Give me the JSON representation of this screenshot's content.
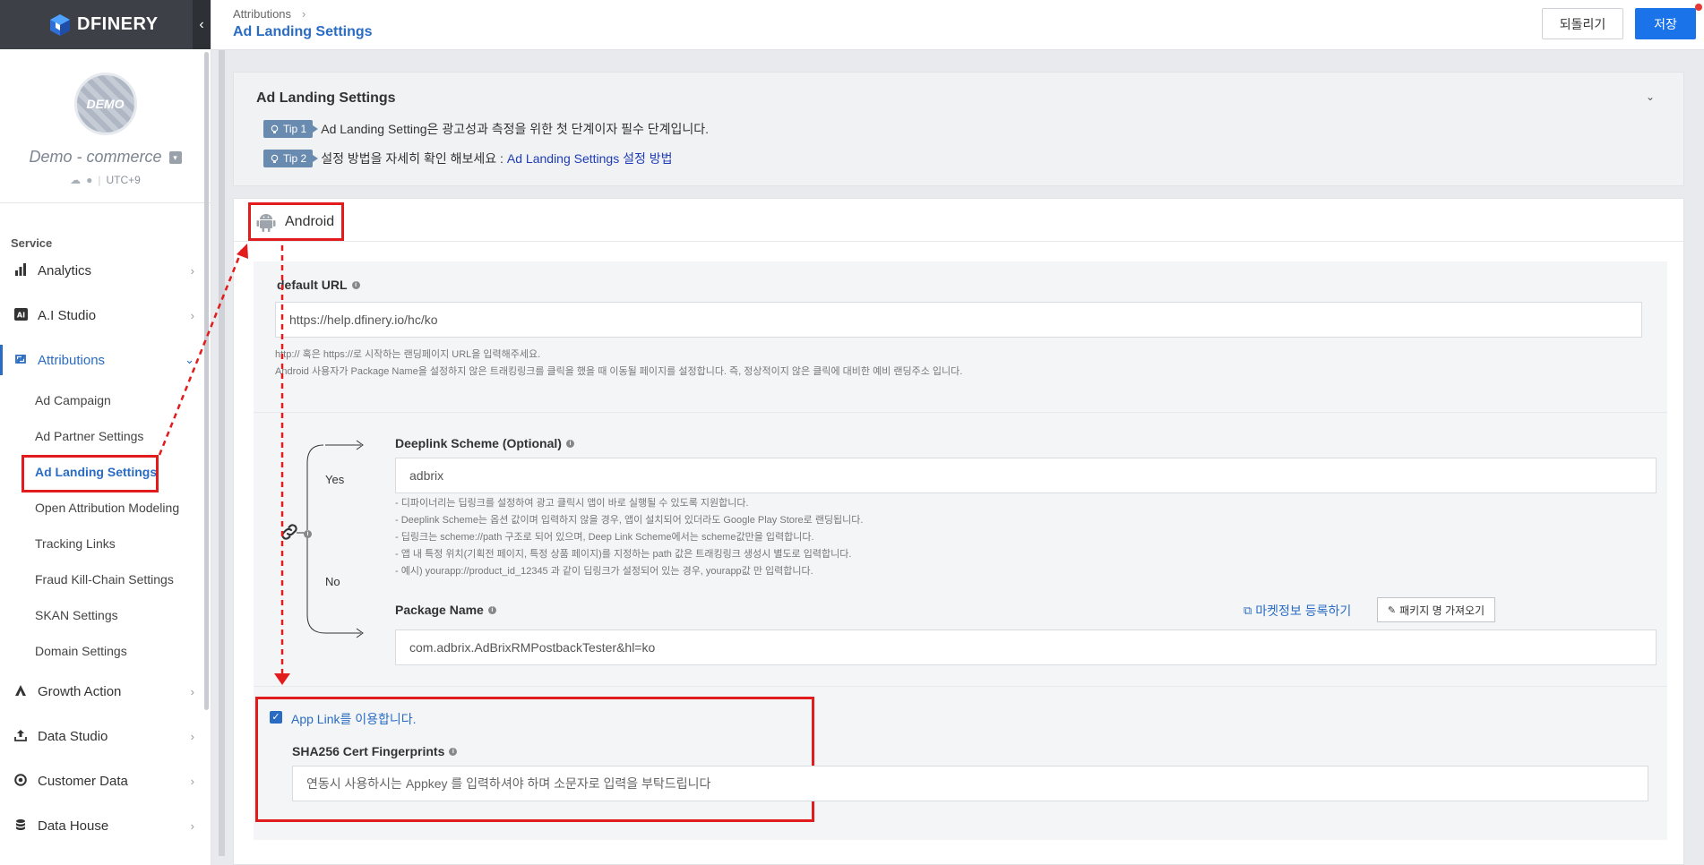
{
  "brand": {
    "name": "DFINERY"
  },
  "profile": {
    "avatar_text": "DEMO",
    "name": "Demo - commerce",
    "timezone": "UTC+9"
  },
  "sidebar": {
    "section_label": "Service",
    "items": [
      {
        "label": "Analytics"
      },
      {
        "label": "A.I Studio"
      },
      {
        "label": "Attributions"
      },
      {
        "label": "Growth Action"
      },
      {
        "label": "Data Studio"
      },
      {
        "label": "Customer Data"
      },
      {
        "label": "Data House"
      }
    ],
    "sub_items": [
      {
        "label": "Ad Campaign"
      },
      {
        "label": "Ad Partner Settings"
      },
      {
        "label": "Ad Landing Settings"
      },
      {
        "label": "Open Attribution Modeling"
      },
      {
        "label": "Tracking Links"
      },
      {
        "label": "Fraud Kill-Chain Settings"
      },
      {
        "label": "SKAN Settings"
      },
      {
        "label": "Domain Settings"
      }
    ]
  },
  "header": {
    "breadcrumb": "Attributions",
    "title": "Ad Landing Settings",
    "revert_label": "되돌리기",
    "save_label": "저장"
  },
  "settings_card": {
    "title": "Ad Landing Settings",
    "tip1_badge": "Tip 1",
    "tip1_text": "Ad Landing Setting은 광고성과 측정을 위한 첫 단계이자 필수 단계입니다.",
    "tip2_badge": "Tip 2",
    "tip2_text": "설정 방법을 자세히 확인 해보세요 :",
    "tip2_link": "Ad Landing Settings 설정 방법"
  },
  "android": {
    "title": "Android",
    "default_url": {
      "label": "default URL",
      "value": "https://help.dfinery.io/hc/ko",
      "help1": "http:// 혹은 https://로 시작하는 랜딩페이지 URL을 입력해주세요.",
      "help2": "Android 사용자가 Package Name을 설정하지 않은 트래킹링크를 클릭을 했을 때 이동될 페이지를 설정합니다. 즉, 정상적이지 않은 클릭에 대비한 예비 랜딩주소 입니다."
    },
    "branch": {
      "yes": "Yes",
      "no": "No"
    },
    "deeplink": {
      "label": "Deeplink Scheme (Optional)",
      "value": "adbrix",
      "help": [
        "- 디파이너리는 딥링크를 설정하여 광고 클릭시 앱이 바로 실행될 수 있도록 지원합니다.",
        "- Deeplink Scheme는 옵션 값이며 입력하지 않을 경우, 앱이 설치되어 있더라도 Google Play Store로 랜딩됩니다.",
        "- 딥링크는 scheme://path 구조로 되어 있으며, Deep Link Scheme에서는 scheme값만을 입력합니다.",
        "- 앱 내 특정 위치(기획전 페이지, 특정 상품 페이지)를 지정하는 path 값은 트래킹링크 생성시 별도로 입력합니다.",
        "- 예시) yourapp://product_id_12345 과 같이 딥링크가 설정되어 있는 경우, yourapp값 만 입력합니다."
      ]
    },
    "package": {
      "label": "Package Name",
      "value": "com.adbrix.AdBrixRMPostbackTester&hl=ko",
      "market_link": "마켓정보 등록하기",
      "fetch_button": "패키지 명 가져오기"
    },
    "applink": {
      "checkbox_label": "App Link를 이용합니다.",
      "sha_label": "SHA256 Cert Fingerprints",
      "sha_placeholder": "연동시 사용하시는 Appkey 를 입력하셔야 하며 소문자로 입력을 부탁드립니다"
    }
  },
  "colors": {
    "accent": "#2a6cc3",
    "highlight": "#e21c1c",
    "save": "#1a73e8"
  }
}
